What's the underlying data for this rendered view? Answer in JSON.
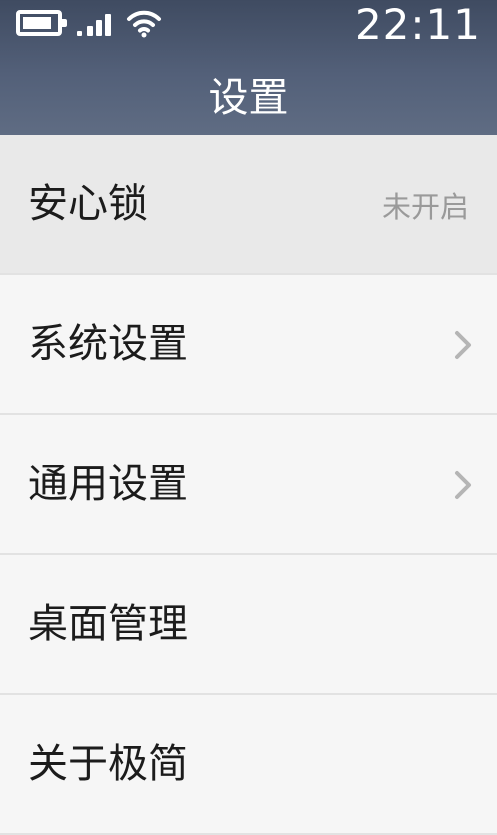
{
  "status_bar": {
    "battery_icon": "battery-icon",
    "signal_icon": "signal-icon",
    "wifi_icon": "wifi-icon",
    "time": "22:11"
  },
  "header": {
    "title": "设置"
  },
  "settings": {
    "items": [
      {
        "label": "安心锁",
        "value": "未开启"
      },
      {
        "label": "系统设置",
        "icon": "chevron-right-icon"
      },
      {
        "label": "通用设置",
        "icon": "chevron-right-icon"
      },
      {
        "label": "桌面管理"
      },
      {
        "label": "关于极简"
      }
    ]
  },
  "colors": {
    "header": "#536079",
    "background": "#f6f6f6",
    "divider": "#e2e2e2",
    "secondary_text": "#9a9a9a"
  }
}
